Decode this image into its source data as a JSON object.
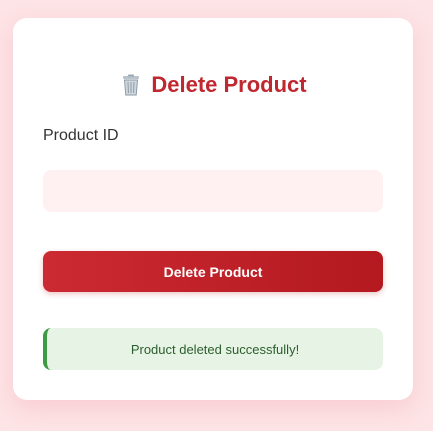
{
  "form": {
    "title": "Delete Product",
    "title_icon": "trash-icon",
    "product_id_label": "Product ID",
    "product_id_value": "",
    "product_id_placeholder": "",
    "delete_button_label": "Delete Product"
  },
  "alert": {
    "type": "success",
    "message": "Product deleted successfully!"
  },
  "colors": {
    "page_background": "#fde4e6",
    "accent": "#c0282f",
    "input_background": "#fff1f2",
    "success_background": "#e7f4e5",
    "success_border": "#3f9a44",
    "success_text": "#2b5e2e"
  }
}
